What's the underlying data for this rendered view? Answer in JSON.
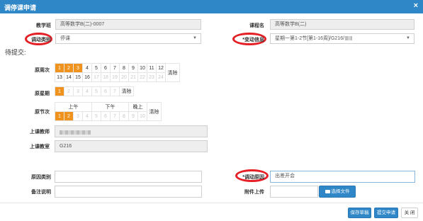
{
  "dialog": {
    "title": "调停课申请",
    "close_glyph": "×"
  },
  "form": {
    "class_label": "教学班",
    "class_value": "高等数学B(二)-0007",
    "course_label": "课程名",
    "course_value": "高等数学B(二)",
    "adjust_type_label": "调动类别",
    "adjust_type_value": "停课",
    "change_info_label": "*变动信息",
    "change_info_value": "星期一第1-2节[第1-16周]/G216/",
    "pending_label": "待提交:",
    "week_label": "原周次",
    "weeks_row1": [
      "1",
      "2",
      "3",
      "4",
      "5",
      "6",
      "7",
      "8",
      "9",
      "10",
      "11",
      "12"
    ],
    "weeks_row2": [
      "13",
      "14",
      "15",
      "16",
      "17",
      "18",
      "19",
      "20",
      "21",
      "22",
      "23",
      "24"
    ],
    "weeks_selected": [
      "1",
      "2",
      "3"
    ],
    "weeks_enabled": [
      "1",
      "2",
      "3",
      "4",
      "5",
      "6",
      "7",
      "8",
      "9",
      "10",
      "11",
      "12",
      "13",
      "14",
      "15",
      "16"
    ],
    "clear_label": "清除",
    "weekday_label": "原星期",
    "weekdays": [
      "1",
      "2",
      "3",
      "4",
      "5",
      "6",
      "7"
    ],
    "weekdays_selected": [
      "1"
    ],
    "period_label": "原节次",
    "period_groups": [
      "上午",
      "下午",
      "晚上"
    ],
    "periods": [
      "1",
      "2",
      "3",
      "4",
      "5",
      "6",
      "7",
      "8",
      "9",
      "10"
    ],
    "periods_selected": [
      "1",
      "2"
    ],
    "teacher_label": "上课教师",
    "room_label": "上课教室",
    "room_value": "G216",
    "reason_type_label": "原因类别",
    "reason_type_value": "",
    "reason_label": "*调动原因",
    "reason_value": "出差开会",
    "remark_label": "备注说明",
    "remark_value": "",
    "attachment_label": "附件上传",
    "file_button_label": "选择文件"
  },
  "footer": {
    "save_draft": "保存草稿",
    "submit": "提交申请",
    "close": "关 闭"
  },
  "colors": {
    "header": "#2f87c8",
    "selected": "#f0931e",
    "highlight": "#e41f26"
  }
}
